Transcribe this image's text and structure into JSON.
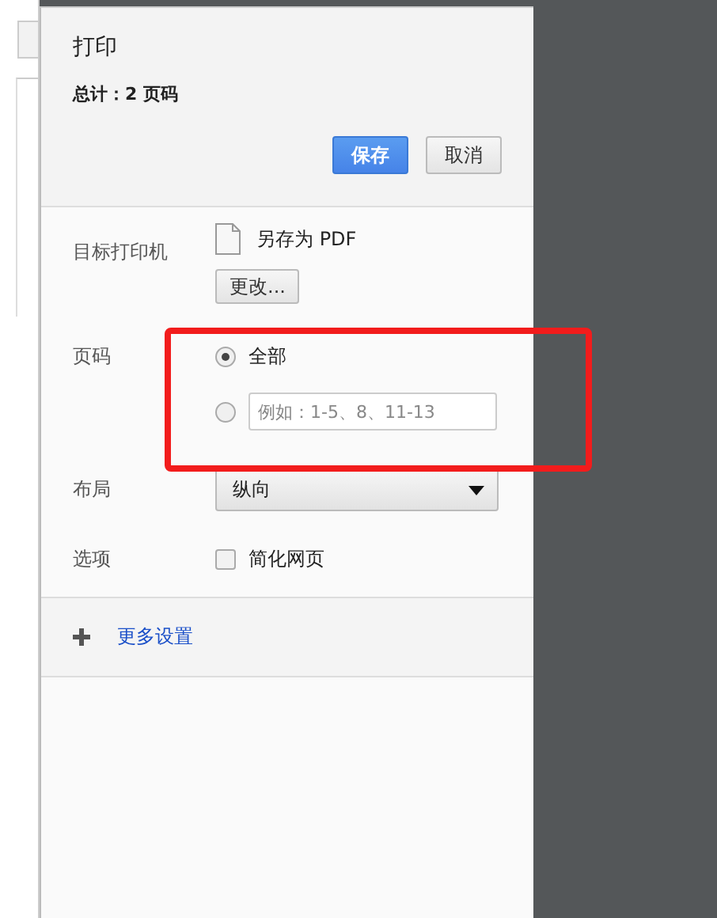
{
  "header": {
    "title": "打印",
    "summary": "总计：2 页码",
    "buttons": [
      {
        "label": "保存",
        "kind": "primary"
      },
      {
        "label": "取消",
        "kind": "normal"
      }
    ]
  },
  "destination": {
    "label": "目标打印机",
    "printer": "另存为 PDF",
    "change_button": "更改..."
  },
  "pages": {
    "label": "页码",
    "options": [
      {
        "kind": "label",
        "text": "全部",
        "selected": true
      },
      {
        "kind": "input",
        "placeholder": "例如：1-5、8、11-13",
        "selected": false
      }
    ]
  },
  "layout": {
    "label": "布局",
    "value": "纵向"
  },
  "options": {
    "label": "选项",
    "checkbox": {
      "text": "简化网页",
      "checked": false
    }
  },
  "more_settings": "更多设置"
}
